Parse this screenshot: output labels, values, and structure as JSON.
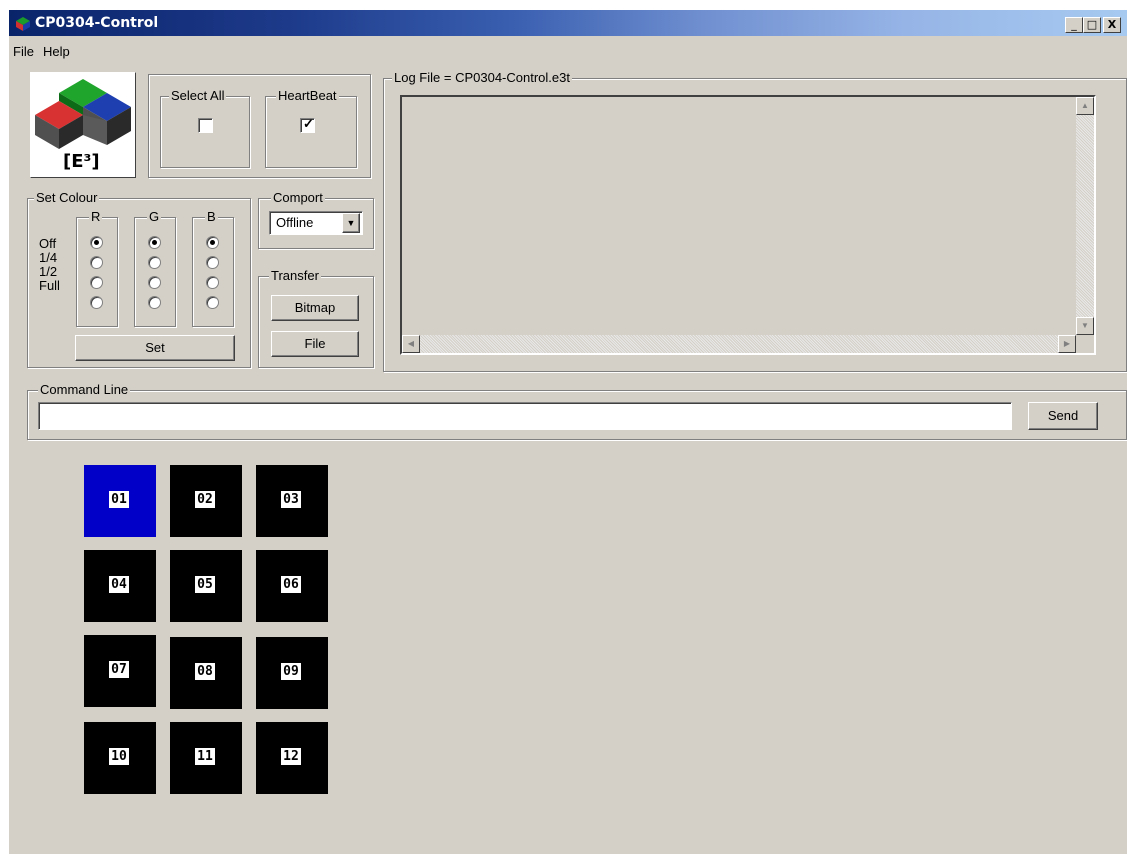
{
  "window": {
    "title": "CP0304-Control",
    "controls": {
      "minimize": "_",
      "maximize": "□",
      "close": "X"
    }
  },
  "menu": {
    "file": "File",
    "help": "Help"
  },
  "logo": {
    "text": "[E³]",
    "colors": {
      "green": "#1a9a2a",
      "red": "#d23030",
      "blue": "#1a3aa8"
    }
  },
  "select_all": {
    "label": "Select All",
    "checked": false
  },
  "heartbeat": {
    "label": "HeartBeat",
    "checked": true
  },
  "set_colour": {
    "title": "Set Colour",
    "levels": [
      "Off",
      "1/4",
      "1/2",
      "Full"
    ],
    "channels": [
      {
        "label": "R",
        "selected": "Off"
      },
      {
        "label": "G",
        "selected": "Off"
      },
      {
        "label": "B",
        "selected": "Off"
      }
    ],
    "set_button": "Set"
  },
  "comport": {
    "title": "Comport",
    "value": "Offline"
  },
  "transfer": {
    "title": "Transfer",
    "bitmap_button": "Bitmap",
    "file_button": "File"
  },
  "log": {
    "title": "Log File = CP0304-Control.e3t",
    "content": ""
  },
  "command_line": {
    "title": "Command Line",
    "value": "",
    "send_button": "Send"
  },
  "tiles": [
    {
      "label": "01",
      "selected": true
    },
    {
      "label": "02",
      "selected": false
    },
    {
      "label": "03",
      "selected": false
    },
    {
      "label": "04",
      "selected": false
    },
    {
      "label": "05",
      "selected": false
    },
    {
      "label": "06",
      "selected": false
    },
    {
      "label": "07",
      "selected": false
    },
    {
      "label": "08",
      "selected": false
    },
    {
      "label": "09",
      "selected": false
    },
    {
      "label": "10",
      "selected": false
    },
    {
      "label": "11",
      "selected": false
    },
    {
      "label": "12",
      "selected": false
    }
  ],
  "colors": {
    "tile_selected": "#0000c8",
    "tile_default": "#000000",
    "face": "#d4d0c8"
  }
}
